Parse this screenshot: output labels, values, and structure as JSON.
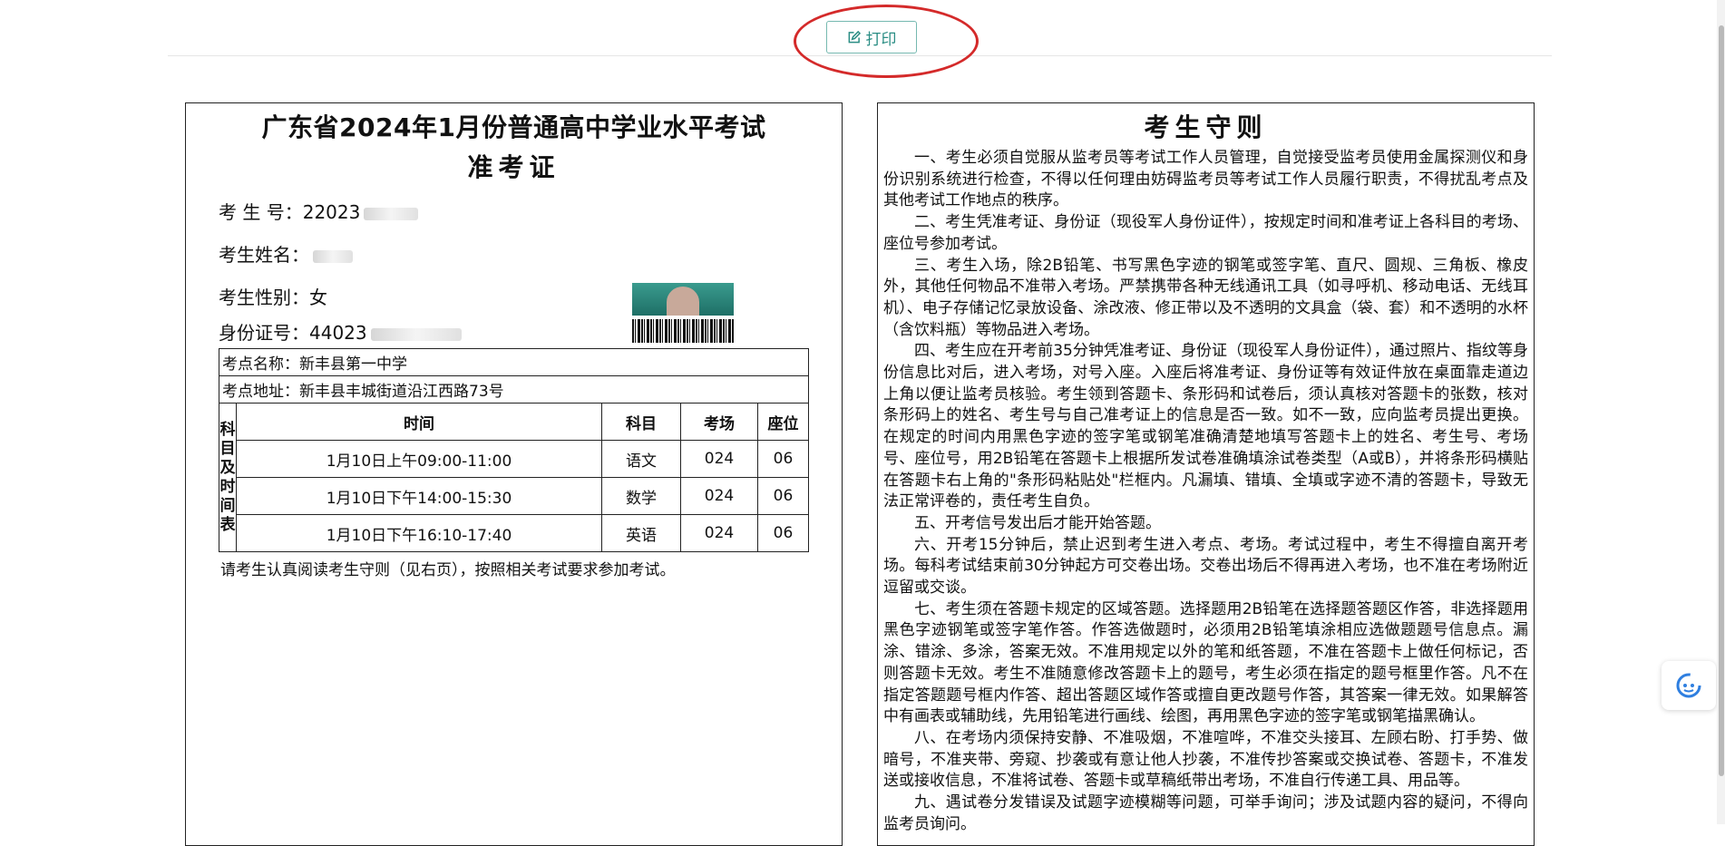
{
  "toolbar": {
    "print_label": "打印",
    "print_icon": "edit-icon"
  },
  "ticket": {
    "title": "广东省2024年1月份普通高中学业水平考试",
    "subtitle": "准考证",
    "fields": {
      "exam_no_label": "考 生 号：",
      "exam_no_value": "22023",
      "name_label": "考生姓名：",
      "name_value": "",
      "gender_label": "考生性别：",
      "gender_value": "女",
      "id_label": "身份证号：",
      "id_value": "44023"
    },
    "site_name": "考点名称：新丰县第一中学",
    "site_address": "考点地址：新丰县丰城街道沿江西路73号",
    "schedule_label": "科目及时间表",
    "schedule_headers": [
      "时间",
      "科目",
      "考场",
      "座位"
    ],
    "schedule": [
      [
        "1月10日上午09:00-11:00",
        "语文",
        "024",
        "06"
      ],
      [
        "1月10日下午14:00-15:30",
        "数学",
        "024",
        "06"
      ],
      [
        "1月10日下午16:10-17:40",
        "英语",
        "024",
        "06"
      ]
    ],
    "note": "请考生认真阅读考生守则（见右页），按照相关考试要求参加考试。"
  },
  "rules": {
    "title": "考生守则",
    "paragraphs": [
      "一、考生必须自觉服从监考员等考试工作人员管理，自觉接受监考员使用金属探测仪和身份识别系统进行检查，不得以任何理由妨碍监考员等考试工作人员履行职责，不得扰乱考点及其他考试工作地点的秩序。",
      "二、考生凭准考证、身份证（现役军人身份证件），按规定时间和准考证上各科目的考场、座位号参加考试。",
      "三、考生入场，除2B铅笔、书写黑色字迹的钢笔或签字笔、直尺、圆规、三角板、橡皮外，其他任何物品不准带入考场。严禁携带各种无线通讯工具（如寻呼机、移动电话、无线耳机）、电子存储记忆录放设备、涂改液、修正带以及不透明的文具盒（袋、套）和不透明的水杯（含饮料瓶）等物品进入考场。",
      "四、考生应在开考前35分钟凭准考证、身份证（现役军人身份证件），通过照片、指纹等身份信息比对后，进入考场，对号入座。入座后将准考证、身份证等有效证件放在桌面靠走道边上角以便让监考员核验。考生领到答题卡、条形码和试卷后，须认真核对答题卡的张数，核对条形码上的姓名、考生号与自己准考证上的信息是否一致。如不一致，应向监考员提出更换。在规定的时间内用黑色字迹的签字笔或钢笔准确清楚地填写答题卡上的姓名、考生号、考场号、座位号，用2B铅笔在答题卡上根据所发试卷准确填涂试卷类型（A或B），并将条形码横贴在答题卡右上角的\"条形码粘贴处\"栏框内。凡漏填、错填、全填或字迹不清的答题卡，导致无法正常评卷的，责任考生自负。",
      "五、开考信号发出后才能开始答题。",
      "六、开考15分钟后，禁止迟到考生进入考点、考场。考试过程中，考生不得擅自离开考场。每科考试结束前30分钟起方可交卷出场。交卷出场后不得再进入考场，也不准在考场附近逗留或交谈。",
      "七、考生须在答题卡规定的区域答题。选择题用2B铅笔在选择题答题区作答，非选择题用黑色字迹钢笔或签字笔作答。作答选做题时，必须用2B铅笔填涂相应选做题题号信息点。漏涂、错涂、多涂，答案无效。不准用规定以外的笔和纸答题，不准在答题卡上做任何标记，否则答题卡无效。考生不准随意修改答题卡上的题号，考生必须在指定的题号框里作答。凡不在指定答题题号框内作答、超出答题区域作答或擅自更改题号作答，其答案一律无效。如果解答中有画表或辅助线，先用铅笔进行画线、绘图，再用黑色字迹的签字笔或钢笔描黑确认。",
      "八、在考场内须保持安静、不准吸烟，不准喧哗，不准交头接耳、左顾右盼、打手势、做暗号，不准夹带、旁窥、抄袭或有意让他人抄袭，不准传抄答案或交换试卷、答题卡，不准发送或接收信息，不准将试卷、答题卡或草稿纸带出考场，不准自行传递工具、用品等。",
      "九、遇试卷分发错误及试题字迹模糊等问题，可举手询问；涉及试题内容的疑问，不得向监考员询问。"
    ]
  }
}
